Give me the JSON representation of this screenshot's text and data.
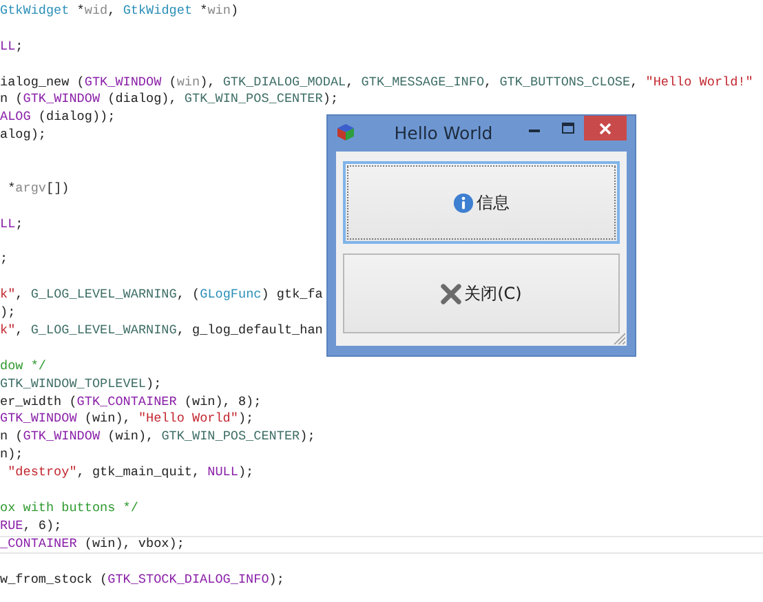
{
  "editor": {
    "lines": [
      {
        "current": false,
        "segments": [
          {
            "text": "GtkWidget",
            "kind": "type"
          },
          {
            "text": " *",
            "kind": "plain"
          },
          {
            "text": "wid",
            "kind": "param"
          },
          {
            "text": ", ",
            "kind": "plain"
          },
          {
            "text": "GtkWidget",
            "kind": "type"
          },
          {
            "text": " *",
            "kind": "plain"
          },
          {
            "text": "win",
            "kind": "param"
          },
          {
            "text": ")",
            "kind": "plain"
          }
        ]
      },
      {
        "current": false
      },
      {
        "current": false,
        "segments": [
          {
            "text": "LL",
            "kind": "macro"
          },
          {
            "text": ";",
            "kind": "plain"
          }
        ]
      },
      {
        "current": false
      },
      {
        "current": false,
        "segments": [
          {
            "text": "ialog_new (",
            "kind": "plain"
          },
          {
            "text": "GTK_WINDOW",
            "kind": "macro"
          },
          {
            "text": " (",
            "kind": "plain"
          },
          {
            "text": "win",
            "kind": "param"
          },
          {
            "text": "), ",
            "kind": "plain"
          },
          {
            "text": "GTK_DIALOG_MODAL",
            "kind": "constant"
          },
          {
            "text": ", ",
            "kind": "plain"
          },
          {
            "text": "GTK_MESSAGE_INFO",
            "kind": "constant"
          },
          {
            "text": ", ",
            "kind": "plain"
          },
          {
            "text": "GTK_BUTTONS_CLOSE",
            "kind": "constant"
          },
          {
            "text": ", ",
            "kind": "plain"
          },
          {
            "text": "\"Hello World!\"",
            "kind": "string"
          }
        ]
      },
      {
        "current": false,
        "segments": [
          {
            "text": "n (",
            "kind": "plain"
          },
          {
            "text": "GTK_WINDOW",
            "kind": "macro"
          },
          {
            "text": " (dialog), ",
            "kind": "plain"
          },
          {
            "text": "GTK_WIN_POS_CENTER",
            "kind": "constant"
          },
          {
            "text": ");",
            "kind": "plain"
          }
        ]
      },
      {
        "current": false,
        "segments": [
          {
            "text": "ALOG",
            "kind": "macro"
          },
          {
            "text": " (dialog));",
            "kind": "plain"
          }
        ]
      },
      {
        "current": false,
        "segments": [
          {
            "text": "alog);",
            "kind": "plain"
          }
        ]
      },
      {
        "current": false
      },
      {
        "current": false
      },
      {
        "current": false,
        "segments": [
          {
            "text": " *",
            "kind": "plain"
          },
          {
            "text": "argv",
            "kind": "param"
          },
          {
            "text": "[])",
            "kind": "plain"
          }
        ]
      },
      {
        "current": false
      },
      {
        "current": false,
        "segments": [
          {
            "text": "LL",
            "kind": "macro"
          },
          {
            "text": ";",
            "kind": "plain"
          }
        ]
      },
      {
        "current": false
      },
      {
        "current": false,
        "segments": [
          {
            "text": ";",
            "kind": "plain"
          }
        ]
      },
      {
        "current": false
      },
      {
        "current": false,
        "segments": [
          {
            "text": "k\"",
            "kind": "string"
          },
          {
            "text": ", ",
            "kind": "plain"
          },
          {
            "text": "G_LOG_LEVEL_WARNING",
            "kind": "constant"
          },
          {
            "text": ", (",
            "kind": "plain"
          },
          {
            "text": "GLogFunc",
            "kind": "type"
          },
          {
            "text": ") gtk_fa",
            "kind": "plain"
          }
        ]
      },
      {
        "current": false,
        "segments": [
          {
            "text": ");",
            "kind": "plain"
          }
        ]
      },
      {
        "current": false,
        "segments": [
          {
            "text": "k\"",
            "kind": "string"
          },
          {
            "text": ", ",
            "kind": "plain"
          },
          {
            "text": "G_LOG_LEVEL_WARNING",
            "kind": "constant"
          },
          {
            "text": ", g_log_default_han",
            "kind": "plain"
          }
        ]
      },
      {
        "current": false
      },
      {
        "current": false,
        "segments": [
          {
            "text": "dow */",
            "kind": "comment"
          }
        ]
      },
      {
        "current": false,
        "segments": [
          {
            "text": "GTK_WINDOW_TOPLEVEL",
            "kind": "constant"
          },
          {
            "text": ");",
            "kind": "plain"
          }
        ]
      },
      {
        "current": false,
        "segments": [
          {
            "text": "er_width (",
            "kind": "plain"
          },
          {
            "text": "GTK_CONTAINER",
            "kind": "macro"
          },
          {
            "text": " (win), 8);",
            "kind": "plain"
          }
        ]
      },
      {
        "current": false,
        "segments": [
          {
            "text": "GTK_WINDOW",
            "kind": "macro"
          },
          {
            "text": " (win), ",
            "kind": "plain"
          },
          {
            "text": "\"Hello World\"",
            "kind": "string"
          },
          {
            "text": ");",
            "kind": "plain"
          }
        ]
      },
      {
        "current": false,
        "segments": [
          {
            "text": "n (",
            "kind": "plain"
          },
          {
            "text": "GTK_WINDOW",
            "kind": "macro"
          },
          {
            "text": " (win), ",
            "kind": "plain"
          },
          {
            "text": "GTK_WIN_POS_CENTER",
            "kind": "constant"
          },
          {
            "text": ");",
            "kind": "plain"
          }
        ]
      },
      {
        "current": false,
        "segments": [
          {
            "text": "n);",
            "kind": "plain"
          }
        ]
      },
      {
        "current": false,
        "segments": [
          {
            "text": " \"destroy\"",
            "kind": "string"
          },
          {
            "text": ", gtk_main_quit, ",
            "kind": "plain"
          },
          {
            "text": "NULL",
            "kind": "macro"
          },
          {
            "text": ");",
            "kind": "plain"
          }
        ]
      },
      {
        "current": false
      },
      {
        "current": false,
        "segments": [
          {
            "text": "ox with buttons */",
            "kind": "comment"
          }
        ]
      },
      {
        "current": false,
        "segments": [
          {
            "text": "RUE",
            "kind": "macro"
          },
          {
            "text": ", 6);",
            "kind": "plain"
          }
        ]
      },
      {
        "current": true,
        "segments": [
          {
            "text": "_CONTAINER",
            "kind": "macro"
          },
          {
            "text": " (win), vbox);",
            "kind": "plain"
          }
        ]
      },
      {
        "current": false
      },
      {
        "current": false,
        "segments": [
          {
            "text": "w_from_stock (",
            "kind": "plain"
          },
          {
            "text": "GTK_STOCK_DIALOG_INFO",
            "kind": "macro"
          },
          {
            "text": ");",
            "kind": "plain"
          }
        ]
      }
    ]
  },
  "window": {
    "title": "Hello World",
    "buttons": [
      {
        "label": "信息",
        "kind": "info",
        "focused": true
      },
      {
        "label": "关闭(C)",
        "kind": "close",
        "focused": false
      }
    ]
  }
}
